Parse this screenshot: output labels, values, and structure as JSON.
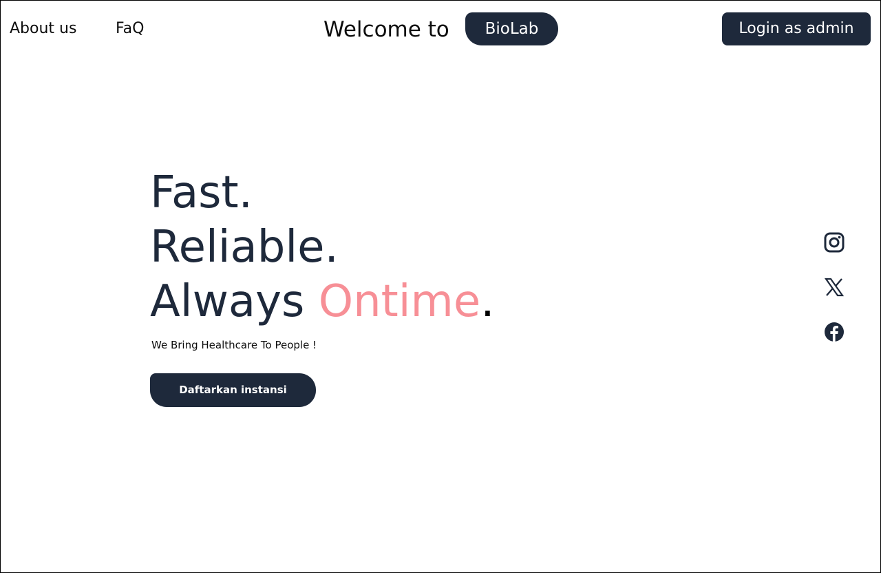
{
  "nav": {
    "about_label": "About us",
    "faq_label": "FaQ"
  },
  "brand": {
    "prefix": "Welcome to",
    "name": "BioLab"
  },
  "header": {
    "login_label": "Login as admin"
  },
  "hero": {
    "line1": "Fast.",
    "line2": "Reliable.",
    "line3_prefix": "Always",
    "line3_accent": "Ontime",
    "line3_suffix": ".",
    "subtitle": "We Bring Healthcare To People !",
    "cta_label": "Daftarkan instansi"
  },
  "social": {
    "icons": [
      "instagram-icon",
      "x-twitter-icon",
      "facebook-icon"
    ]
  },
  "colors": {
    "primary": "#1e293b",
    "accent": "#f78f96",
    "background": "#ffffff"
  }
}
